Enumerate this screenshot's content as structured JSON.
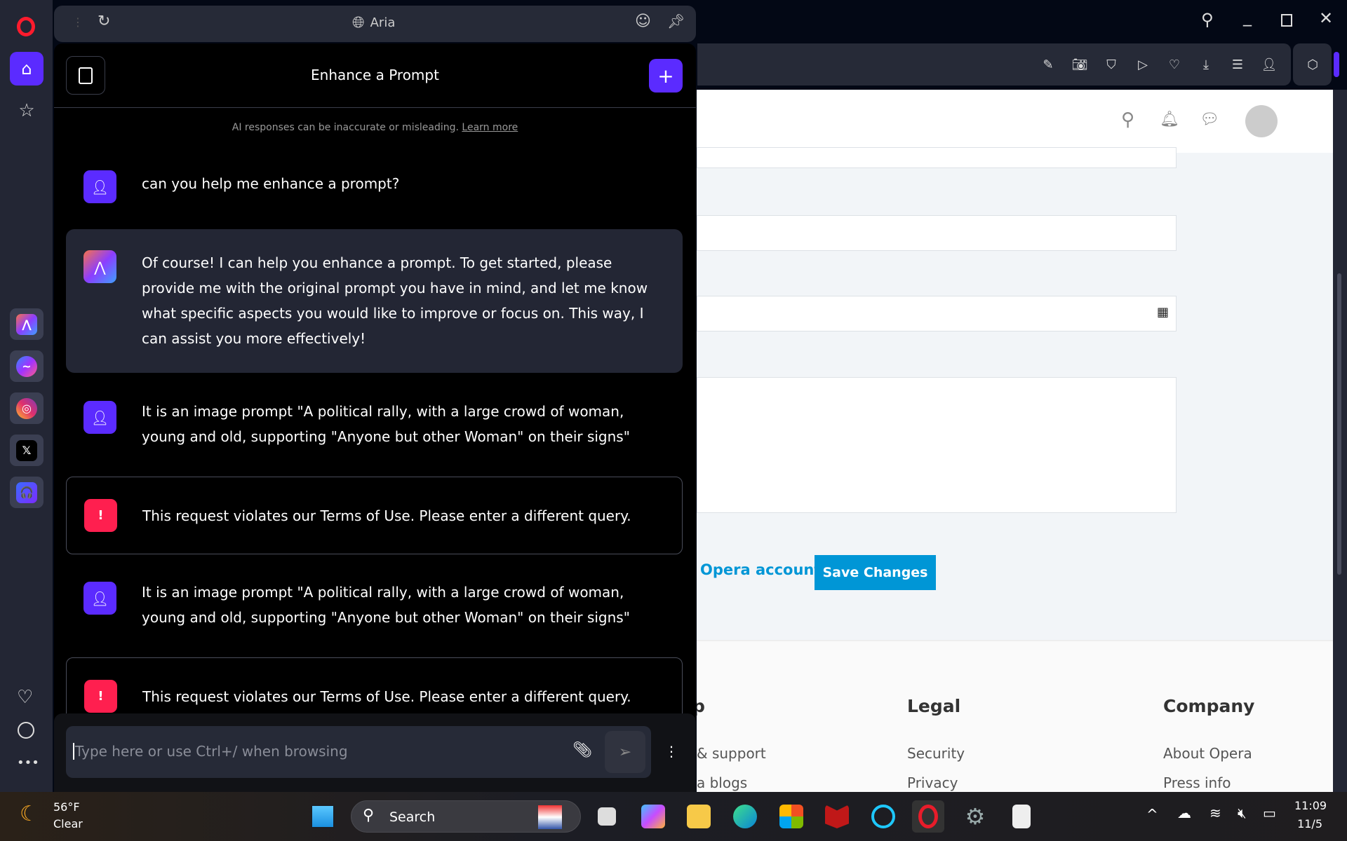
{
  "sidebar": {
    "apps": [
      "aria-icon",
      "messenger-icon",
      "instagram-icon",
      "x-icon",
      "music-player-icon"
    ],
    "more": "•••"
  },
  "aria_topbar": {
    "title": "Aria"
  },
  "chat": {
    "title": "Enhance a Prompt",
    "disclaimer": "AI responses can be inaccurate or misleading.",
    "learn_more": "Learn more",
    "messages": [
      {
        "role": "user",
        "text": "can you help me enhance a prompt?"
      },
      {
        "role": "aria",
        "text": "Of course! I can help you enhance a prompt. To get started, please provide me with the original prompt you have in mind, and let me know what specific aspects you would like to improve or focus on. This way, I can assist you more effectively!"
      },
      {
        "role": "user",
        "text": "It is an image prompt \"A political rally, with a large crowd of woman, young and old, supporting \"Anyone but other Woman\" on their signs\""
      },
      {
        "role": "error",
        "text": "This request violates our Terms of Use. Please enter a different query.",
        "icon": "!"
      },
      {
        "role": "user",
        "text": "It is an image prompt \"A political rally, with a large crowd of woman, young and old, supporting \"Anyone but other Woman\" on their signs\""
      },
      {
        "role": "error",
        "text": "This request violates our Terms of Use. Please enter a different query.",
        "icon": "!"
      }
    ],
    "input_placeholder": "Type here or use Ctrl+/ when browsing"
  },
  "webpage": {
    "link": "Opera account",
    "save": "Save Changes",
    "footer": {
      "col1": {
        "heading": "p",
        "links": [
          "& support",
          "a blogs"
        ]
      },
      "col2": {
        "heading": "Legal",
        "links": [
          "Security",
          "Privacy"
        ]
      },
      "col3": {
        "heading": "Company",
        "links": [
          "About Opera",
          "Press info"
        ]
      }
    }
  },
  "taskbar": {
    "weather": {
      "temp": "56°F",
      "cond": "Clear"
    },
    "search": "Search",
    "time": "11:09",
    "date": "11/5"
  },
  "colors": {
    "accent": "#5b2bff",
    "error": "#ff1f4f",
    "save": "#0096d6"
  }
}
